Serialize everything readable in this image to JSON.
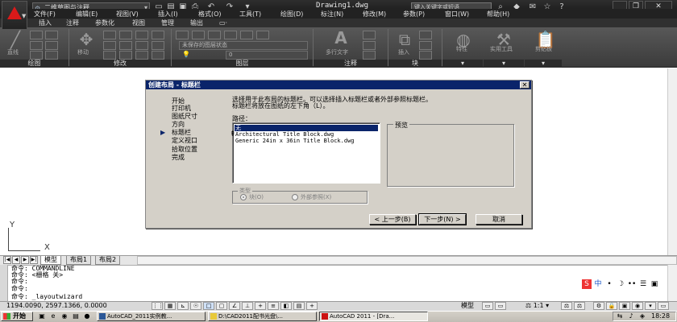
{
  "titlebar": {
    "workspace": "二维草图与注释",
    "document": "Drawing1.dwg",
    "search_placeholder": "键入关键字或短语"
  },
  "menu": [
    "文件(F)",
    "编辑(E)",
    "视图(V)",
    "插入(I)",
    "格式(O)",
    "工具(T)",
    "绘图(D)",
    "标注(N)",
    "修改(M)",
    "参数(P)",
    "窗口(W)",
    "帮助(H)"
  ],
  "ribbon_tabs": [
    "常用",
    "插入",
    "注释",
    "参数化",
    "视图",
    "管理",
    "输出"
  ],
  "ribbon": {
    "draw_tools": [
      "直线"
    ],
    "modify_tools": [
      "移动"
    ],
    "layer_state": "未保存的图层状态",
    "layer_value": "0",
    "annotation_tools": [
      "多行文字"
    ],
    "block_tools": [
      "插入"
    ],
    "big_tools": [
      "特性",
      "实用工具",
      "剪贴板"
    ],
    "panels": [
      "绘图",
      "修改",
      "图层",
      "注释",
      "块"
    ]
  },
  "ucs": {
    "x": "X",
    "y": "Y"
  },
  "layout_tabs": [
    "模型",
    "布局1",
    "布局2"
  ],
  "command_lines": [
    "命令: COMMANDLINE",
    "命令: <栅格 关>",
    "命令:",
    "命令:",
    "命令: _layoutwizard"
  ],
  "status": {
    "coords": "1194.0090, 2597.1366, 0.0000",
    "model": "模型",
    "scale": "1:1"
  },
  "taskbar": {
    "start": "开始",
    "tasks": [
      "AutoCAD_2011实例教...",
      "D:\\CAD2011配书光盘\\...",
      "AutoCAD 2011 - [Dra..."
    ],
    "clock": "18:28"
  },
  "ime": [
    "S",
    "中",
    "•",
    "☽",
    "••",
    "☰",
    "▣"
  ],
  "dialog": {
    "title": "创建布局 - 标题栏",
    "close": "✕",
    "steps": [
      "开始",
      "打印机",
      "图纸尺寸",
      "方向",
      "标题栏",
      "定义视口",
      "拾取位置",
      "完成"
    ],
    "active_step": 4,
    "instruction": [
      "选择用于此布局的标题栏。可以选择插入标题栏或者外部参照标题栏。",
      "标题栏将放在图纸的左下角（L）。"
    ],
    "path_label": "路径：",
    "path_items": [
      "无",
      "Architectural Title Block.dwg",
      "Generic 24in x 36in Title Block.dwg"
    ],
    "preview_label": "预览",
    "type_label": "类型",
    "type_options": [
      "块(O)",
      "外部参照(X)"
    ],
    "buttons": {
      "back": "< 上一步(B)",
      "next": "下一步(N) >",
      "cancel": "取消"
    }
  }
}
